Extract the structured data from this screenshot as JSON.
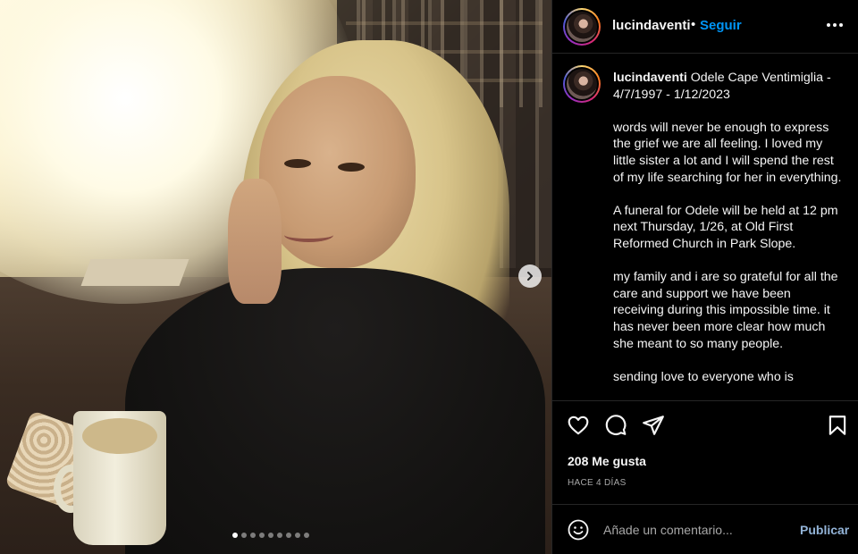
{
  "post": {
    "username": "lucindaventi",
    "separator": "•",
    "follow_label": "Seguir",
    "caption_title": "Odele Cape Ventimiglia - 4/7/1997 - 1/12/2023",
    "caption_body": "words will never be enough to express the grief we are all feeling. I loved my little sister a lot and I will spend the rest of my life searching for her in everything.\n\nA funeral for Odele will be held at 12 pm next Thursday, 1/26, at Old First Reformed Church in Park Slope.\n\nmy family and i are so grateful for all the care and support we have been receiving during this impossible time. it has never been more clear how much she meant to so many people.\n\nsending love to everyone who is",
    "likes": "208 Me gusta",
    "time_ago": "HACE 4 DÍAS",
    "comment_placeholder": "Añade un comentario...",
    "publish_label": "Publicar"
  },
  "carousel": {
    "total_slides": 9,
    "active_index": 0
  },
  "icons": {
    "like": "heart-icon",
    "comment": "comment-icon",
    "share": "share-icon",
    "save": "bookmark-icon",
    "emoji": "emoji-icon",
    "more": "more-icon",
    "next": "chevron-right-icon"
  },
  "colors": {
    "accent": "#0095f6",
    "publish": "#93b4d8",
    "background": "#000000",
    "divider": "#262626"
  }
}
